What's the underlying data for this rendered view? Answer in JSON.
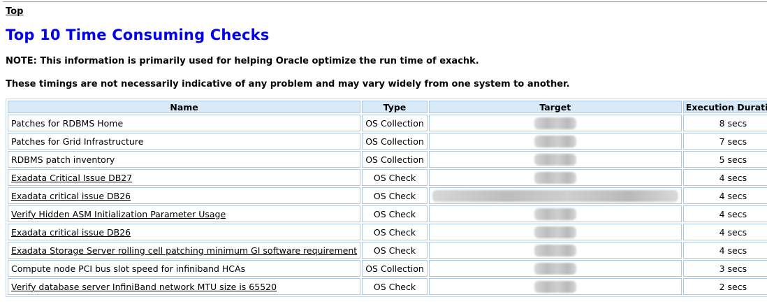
{
  "nav": {
    "top_link": "Top"
  },
  "section": {
    "title": "Top 10 Time Consuming Checks",
    "note": "NOTE: This information is primarily used for helping Oracle optimize the run time of exachk.",
    "disclaimer": "These timings are not necessarily indicative of any problem and may vary widely from one system to another."
  },
  "table": {
    "headers": [
      "Name",
      "Type",
      "Target",
      "Execution Duration"
    ],
    "rows": [
      {
        "name": "Patches for RDBMS Home",
        "link": false,
        "type": "OS Collection",
        "target": "redacted",
        "duration": "8 secs"
      },
      {
        "name": "Patches for Grid Infrastructure",
        "link": false,
        "type": "OS Collection",
        "target": "redacted",
        "duration": "7 secs"
      },
      {
        "name": "RDBMS patch inventory",
        "link": false,
        "type": "OS Collection",
        "target": "redacted",
        "duration": "5 secs"
      },
      {
        "name": "Exadata Critical Issue DB27",
        "link": true,
        "type": "OS Check",
        "target": "redacted",
        "duration": "4 secs"
      },
      {
        "name": "Exadata critical issue DB26",
        "link": true,
        "type": "OS Check",
        "target": "redacted-long",
        "duration": "4 secs"
      },
      {
        "name": "Verify Hidden ASM Initialization Parameter Usage",
        "link": true,
        "type": "OS Check",
        "target": "redacted",
        "duration": "4 secs"
      },
      {
        "name": "Exadata critical issue DB26",
        "link": true,
        "type": "OS Check",
        "target": "redacted",
        "duration": "4 secs"
      },
      {
        "name": "Exadata Storage Server rolling cell patching minimum GI software requirement",
        "link": true,
        "type": "OS Check",
        "target": "redacted",
        "duration": "4 secs"
      },
      {
        "name": "Compute node PCI bus slot speed for infiniband HCAs",
        "link": false,
        "type": "OS Collection",
        "target": "redacted",
        "duration": "3 secs"
      },
      {
        "name": "Verify database server InfiniBand network MTU size is 65520",
        "link": true,
        "type": "OS Check",
        "target": "redacted",
        "duration": "2 secs"
      }
    ]
  },
  "colors": {
    "title": "#0000ee",
    "header_bg": "#d8eaf8",
    "cell_border": "#a9c8e6"
  }
}
